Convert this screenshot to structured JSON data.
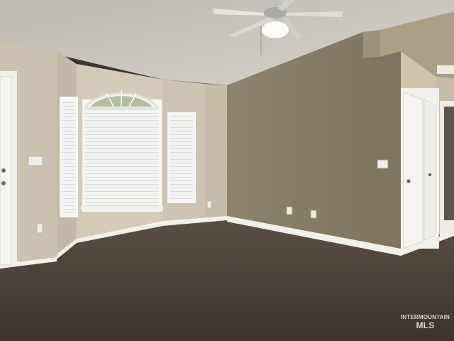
{
  "scene": {
    "description_free": true,
    "colors": {
      "ceiling": "#c9c4bd",
      "left_wall": "#cfc5b5",
      "accent_wall": "#867d66",
      "floor": "#4a4038",
      "trim": "#f2f0ea",
      "window_glass": "#eef0ee",
      "door": "#f4f3ef"
    }
  },
  "watermark": {
    "line1": "INTERMOUNTAIN",
    "line2": "MLS"
  }
}
